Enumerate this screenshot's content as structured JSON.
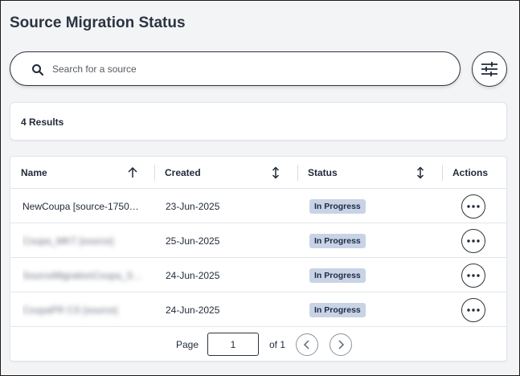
{
  "page": {
    "title": "Source Migration Status"
  },
  "search": {
    "placeholder": "Search for a source",
    "value": ""
  },
  "results": {
    "count_label": "4 Results"
  },
  "table": {
    "columns": [
      {
        "label": "Name",
        "sort_icon": "arrow-up-icon"
      },
      {
        "label": "Created",
        "sort_icon": "sort-vertical-icon"
      },
      {
        "label": "Status",
        "sort_icon": "sort-vertical-icon"
      },
      {
        "label": "Actions"
      }
    ],
    "rows": [
      {
        "name": "NewCoupa [source-17506…",
        "created": "23-Jun-2025",
        "status": "In Progress",
        "blurred": false
      },
      {
        "name": "Coupa_MKT [source]",
        "created": "25-Jun-2025",
        "status": "In Progress",
        "blurred": true
      },
      {
        "name": "SourceMigrationCoupa_S…",
        "created": "24-Jun-2025",
        "status": "In Progress",
        "blurred": true
      },
      {
        "name": "CoupaPR CS [source]",
        "created": "24-Jun-2025",
        "status": "In Progress",
        "blurred": true
      }
    ]
  },
  "pagination": {
    "page_label": "Page",
    "current_page": "1",
    "of_label": "of 1"
  },
  "colors": {
    "badge_bg": "#c9d3e6",
    "badge_text": "#1f2a44",
    "border": "#2f3338"
  }
}
